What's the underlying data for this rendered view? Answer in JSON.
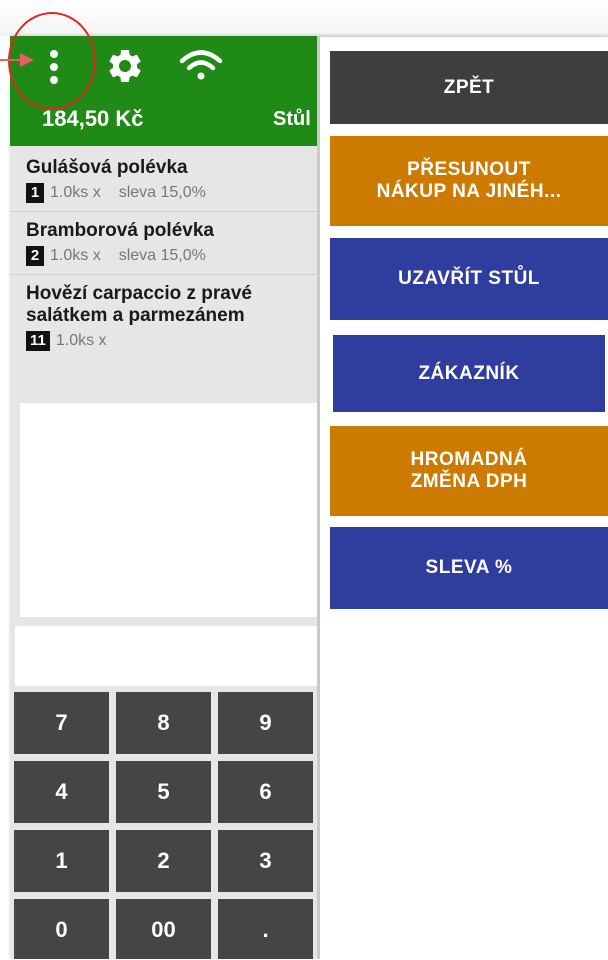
{
  "header": {
    "total": "184,50 Kč",
    "table_label": "Stůl",
    "icons": [
      "more-vert-icon",
      "gear-icon",
      "wifi-icon"
    ],
    "header_color": "#1f8a16"
  },
  "order": {
    "items": [
      {
        "name": "Gulášová polévka",
        "qty_badge": "1",
        "qty": "1.0ks x",
        "discount": "sleva 15,0%"
      },
      {
        "name": "Bramborová polévka",
        "qty_badge": "2",
        "qty": "1.0ks x",
        "discount": "sleva 15,0%"
      },
      {
        "name": "Hovězí carpaccio z pravé",
        "name_line2": "salátkem a parmezánem",
        "qty_badge": "11",
        "qty": "1.0ks x",
        "discount": ""
      }
    ]
  },
  "keypad": {
    "keys": [
      "7",
      "8",
      "9",
      "4",
      "5",
      "6",
      "1",
      "2",
      "3",
      "0",
      "00",
      "."
    ]
  },
  "actions": {
    "back": "ZPĚT",
    "move_line1": "PŘESUNOUT",
    "move_line2": "NÁKUP NA JINÉH...",
    "close_table": "UZAVŘÍT STŮL",
    "customer": "ZÁKAZNÍK",
    "vat_line1": "HROMADNÁ",
    "vat_line2": "ZMĚNA DPH",
    "discount": "SLEVA %",
    "colors": {
      "dark": "#3e3e3e",
      "orange": "#cc7a00",
      "blue": "#2f3d9e"
    }
  }
}
